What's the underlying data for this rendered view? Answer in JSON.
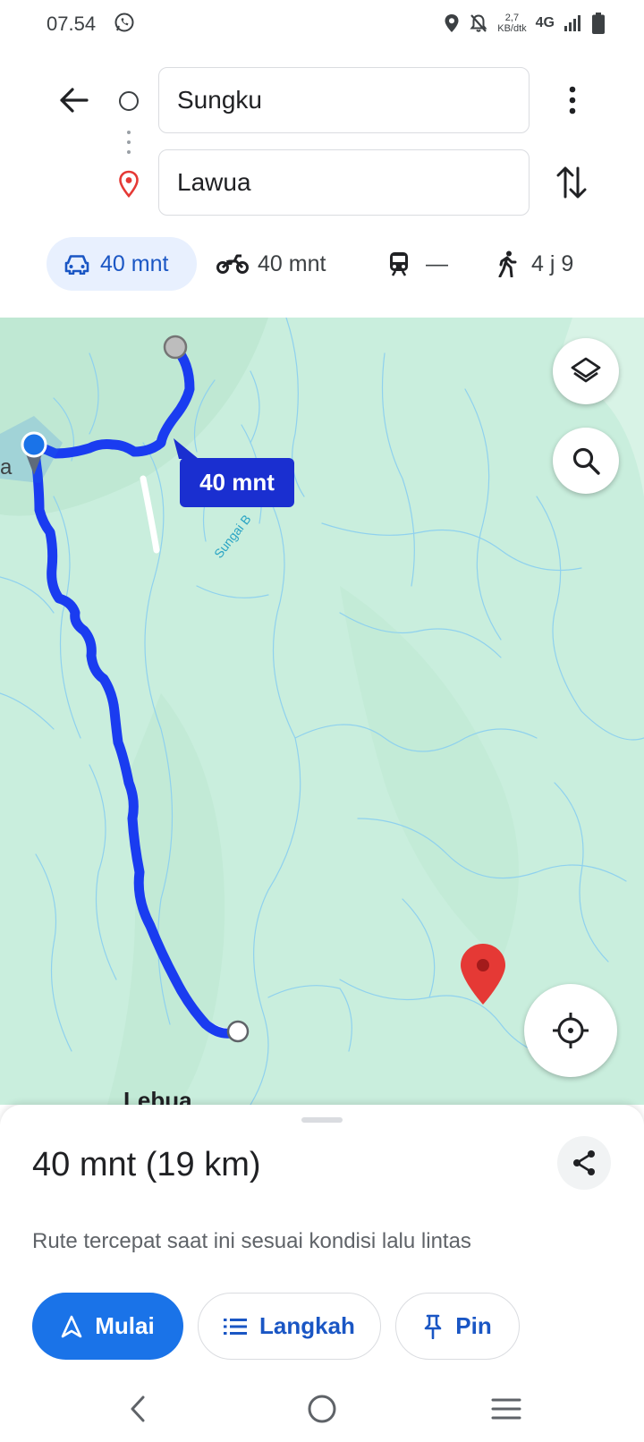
{
  "status_bar": {
    "time": "07.54",
    "net_speed_value": "2,7",
    "net_speed_unit": "KB/dtk",
    "net_type": "4G",
    "icons": [
      "whatsapp-icon",
      "location-icon",
      "bell-off-icon",
      "signal-icon",
      "battery-icon"
    ]
  },
  "directions": {
    "origin": "Sungku",
    "destination": "Lawua"
  },
  "modes": {
    "car": "40 mnt",
    "motorcycle": "40 mnt",
    "transit": "—",
    "walk": "4 j 9"
  },
  "map": {
    "route_label": "40 mnt",
    "river_label": "Sungai B",
    "place_left": "a",
    "place_bottom": "Lebua",
    "colors": {
      "route": "#1a3cf0",
      "land": "#c9eedd",
      "water": "#8fd1ee",
      "pin": "#e53935"
    }
  },
  "sheet": {
    "summary": "40 mnt (19 km)",
    "description": "Rute tercepat saat ini sesuai kondisi lalu lintas",
    "buttons": {
      "start": "Mulai",
      "steps": "Langkah",
      "pin": "Pin"
    }
  }
}
